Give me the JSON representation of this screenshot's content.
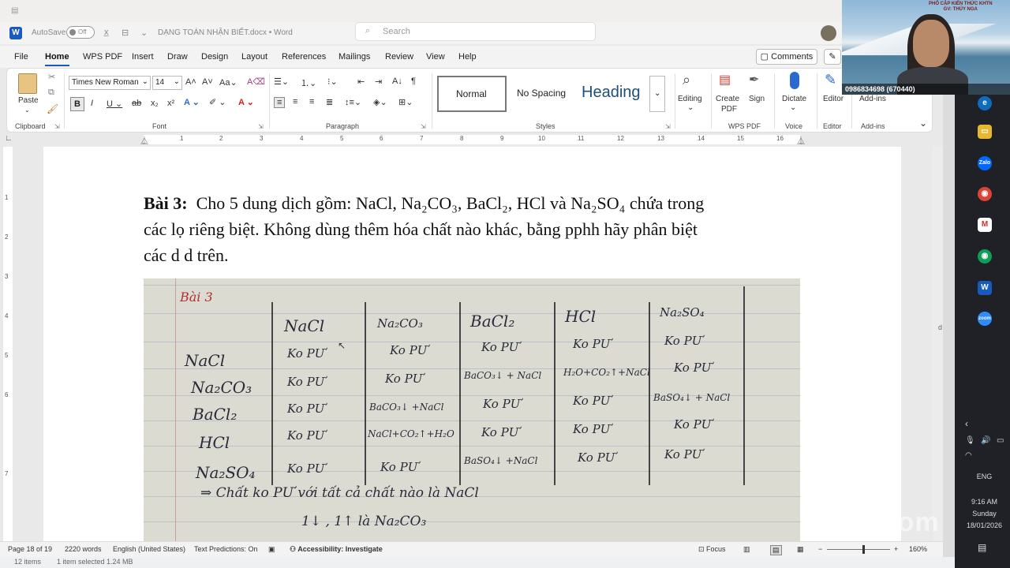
{
  "word": {
    "autosave_label": "AutoSave",
    "autosave_state": "Off",
    "doc_title": "DẠNG TOÁN NHẬN BIẾT.docx  •  Word",
    "search_placeholder": "Search"
  },
  "menu": [
    "File",
    "Home",
    "WPS PDF",
    "Insert",
    "Draw",
    "Design",
    "Layout",
    "References",
    "Mailings",
    "Review",
    "View",
    "Help"
  ],
  "comments_label": "Comments",
  "ribbon": {
    "clipboard": {
      "paste": "Paste",
      "label": "Clipboard"
    },
    "font": {
      "name": "Times New Roman",
      "size": "14",
      "label": "Font"
    },
    "paragraph": {
      "label": "Paragraph"
    },
    "styles": {
      "normal": "Normal",
      "no_spacing": "No Spacing",
      "heading": "Heading",
      "label": "Styles"
    },
    "editing": {
      "label": "Editing"
    },
    "create_pdf": {
      "label1": "Create",
      "label2": "PDF"
    },
    "sign": {
      "label": "Sign"
    },
    "wps_pdf_group": "WPS PDF",
    "dictate": {
      "label": "Dictate",
      "group": "Voice"
    },
    "editor": {
      "label": "Editor",
      "group": "Editor"
    },
    "addins": {
      "label": "Add-ins",
      "group": "Add-ins"
    }
  },
  "ruler_numbers": [
    "1",
    "2",
    "3",
    "4",
    "5",
    "6",
    "7",
    "8",
    "9",
    "10",
    "11",
    "12",
    "13",
    "14",
    "15",
    "16"
  ],
  "vruler_numbers": [
    "1",
    "2",
    "3",
    "4",
    "5",
    "6",
    "7"
  ],
  "document": {
    "problem_label": "Bài 3:",
    "problem_line1": "Cho 5 dung dịch gồm: NaCl, Na₂CO₃, BaCl₂, HCl và Na₂SO₄ chứa trong",
    "problem_line2": "các lọ riêng biệt. Không dùng thêm hóa chất nào khác, bằng pphh hãy phân biệt",
    "problem_line3": "các d d trên."
  },
  "photo": {
    "title": "Bài 3",
    "col_headers": [
      "NaCl",
      "Na₂CO₃",
      "BaCl₂",
      "HCl",
      "Na₂SO₄"
    ],
    "row_headers": [
      "NaCl",
      "Na₂CO₃",
      "BaCl₂",
      "HCl",
      "Na₂SO₄"
    ],
    "cells": [
      [
        "Ko PƯ",
        "Ko PƯ",
        "Ko PƯ",
        "Ko PƯ",
        "Ko PƯ"
      ],
      [
        "Ko PƯ",
        "Ko PƯ",
        "BaCO₃↓ + NaCl",
        "H₂O+CO₂↑+NaCl",
        "Ko PƯ"
      ],
      [
        "Ko PƯ",
        "BaCO₃↓ +NaCl",
        "Ko PƯ",
        "Ko PƯ",
        "BaSO₄↓ + NaCl"
      ],
      [
        "Ko PƯ",
        "NaCl+CO₂↑+H₂O",
        "Ko PƯ",
        "Ko PƯ",
        "Ko PƯ"
      ],
      [
        "Ko PƯ",
        "Ko PƯ",
        "BaSO₄↓ +NaCl",
        "Ko PƯ",
        "Ko PƯ"
      ]
    ],
    "note1": "⇒ Chất ko PƯ với tất cả chất nào là NaCl",
    "note2": "1↓ , 1↑ là Na₂CO₃"
  },
  "status": {
    "page": "Page 18 of 19",
    "words": "2220 words",
    "language": "English (United States)",
    "predictions": "Text Predictions: On",
    "accessibility": "Accessibility: Investigate",
    "focus": "Focus",
    "zoom": "160%"
  },
  "bottom_strip": {
    "items": "12 items",
    "selected": "1 item selected  1.24 MB"
  },
  "camera": {
    "caption": "0986834698 (670440)",
    "brand_line1": "PHỔ CẬP KIẾN THỨC KHTN",
    "brand_line2": "GV: THÚY NGA"
  },
  "taskbar": {
    "lang": "ENG",
    "time": "9:16 AM",
    "day": "Sunday",
    "date": "18/01/2026",
    "icons": [
      "edge-icon",
      "file-explorer-icon",
      "zalo-icon",
      "chrome-icon",
      "gmail-icon",
      "chrome-profile-icon",
      "word-icon",
      "zoom-icon"
    ]
  },
  "zoom_watermark": "zoom",
  "colors": {
    "word_blue": "#185abd",
    "taskbar": "#1f2127",
    "page": "#ffffff"
  }
}
